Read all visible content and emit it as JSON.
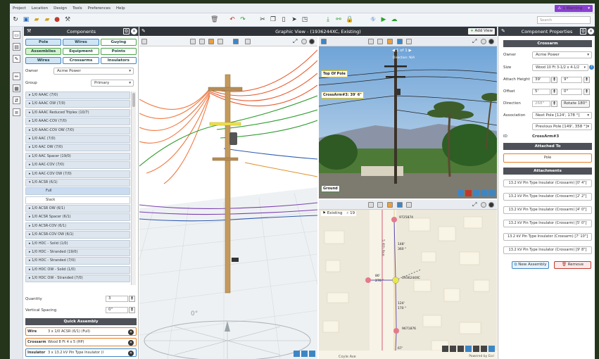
{
  "menu": [
    "Project",
    "Location",
    "Design",
    "Tools",
    "Preferences",
    "Help"
  ],
  "warning": "1 Warning",
  "search_placeholder": "Search",
  "components": {
    "title": "Components",
    "tabs_row1": [
      "Pole",
      "Wires",
      "Guying"
    ],
    "tabs_row2": [
      "Assemblies",
      "Equipment",
      "Points"
    ],
    "tabs_row3": [
      "Wires",
      "Crossarms",
      "Insulators"
    ],
    "owner_label": "Owner",
    "owner_value": "Acme Power",
    "group_label": "Group",
    "group_value": "Primary",
    "items": [
      "1/0 AAAC (7/0)",
      "1/0 AAAC OW (7/0)",
      "1/0 AAAC Reduced Triplex (10/7)",
      "1/0 AAAC-COV (7/0)",
      "1/0 AAAC-COV OW (7/0)",
      "1/0 AAC (7/0)",
      "1/0 AAC OW (7/0)",
      "1/0 AAC Spacer (19/0)",
      "1/0 AAC-COV (7/0)",
      "1/0 AAC-COV OW (7/0)",
      "1/0 ACSR (6/1)"
    ],
    "sub_items": [
      "Full",
      "Slack"
    ],
    "items2": [
      "1/0 ACSR OW (6/1)",
      "1/0 ACSR Spacer (6/1)",
      "1/0 ACSR-COV (6/1)",
      "1/0 ACSR-COV OW (6/1)",
      "1/0 HDC - Solid (1/0)",
      "1/0 HDC - Stranded (19/0)",
      "1/0 HDC - Stranded (7/0)",
      "1/0 HDC OW - Solid (1/0)",
      "1/0 HDC OW - Stranded (7/0)"
    ],
    "quantity_label": "Quantity",
    "quantity_value": "3",
    "spacing_label": "Vertical Spacing",
    "spacing_value": "0\"",
    "quick_title": "Quick Assembly",
    "quick": [
      {
        "type": "Wire",
        "desc": "3 x  1/0 ACSR (6/1) (Full)",
        "color": "#e67e22"
      },
      {
        "type": "Crossarm",
        "desc": "Wood 8 Ft 4 x 5 (HP)",
        "color": "#e67e22"
      },
      {
        "type": "Insulator",
        "desc": "3 x  13.2 kV Pin Type Insulator (I",
        "color": "#3d86c6"
      }
    ]
  },
  "graphic": {
    "title": "Graphic View - (1936244XC, Existing)",
    "add_view": "Add View",
    "photo_nav": "1 of 1",
    "photo_dir": "Direction: N/A",
    "labels": {
      "top": "Top Of Pole",
      "crossarm": "CrossArm#3: 39' 6\"",
      "ground": "Ground"
    },
    "map_state": "Existing",
    "map_zoom": "19",
    "map_street": "S 4th Ave",
    "map_street2": "Coyle Ave",
    "map_powered": "Powered by Esri",
    "map_poles": [
      "9725874",
      "1936244XC",
      "9671876"
    ],
    "map_spans": [
      "148'",
      "360 °",
      "124'",
      "170 °",
      "86'",
      "270 °",
      "67'"
    ]
  },
  "props": {
    "title": "Component Properties",
    "section": "Crossarm",
    "owner_label": "Owner",
    "owner_value": "Acme Power",
    "size_label": "Size",
    "size_value": "Wood 10 Ft 3-1/2 x 4-1/2",
    "attach_label": "Attach Height",
    "attach_ft": "39'",
    "attach_in": "9\"",
    "offset_label": "Offset",
    "offset_ft": "5'",
    "offset_in": "0\"",
    "direction_label": "Direction",
    "direction_value": "268°",
    "rotate_label": "Rotate 180°",
    "assoc_label": "Association",
    "assoc_next": "Next Pole [124', 178 °]",
    "assoc_prev": "Previous Pole [149', 358 °]",
    "id_label": "ID",
    "id_value": "CrossArm#3",
    "attached_title": "Attached To",
    "attached_value": "Pole",
    "attachments_title": "Attachments",
    "attachments": [
      "13.2 kV Pin Type Insulator (Crossarm) [0' 4\"]",
      "13.2 kV Pin Type Insulator (Crossarm) [2' 2\"]",
      "13.2 kV Pin Type Insulator (Crossarm) [4' 0\"]",
      "13.2 kV Pin Type Insulator (Crossarm) [5' 0\"]",
      "13.2 kV Pin Type Insulator (Crossarm) [7' 10\"]",
      "13.2 kV Pin Type Insulator (Crossarm) [9' 8\"]"
    ],
    "new_assembly": "New Assembly",
    "remove": "Remove"
  }
}
